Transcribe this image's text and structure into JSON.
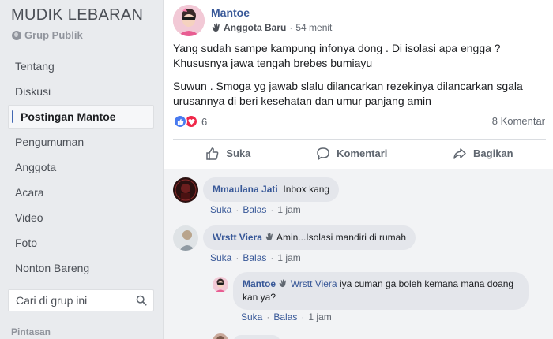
{
  "group": {
    "title": "MUDIK LEBARAN",
    "type": "Grup Publik"
  },
  "nav": {
    "items": [
      {
        "label": "Tentang"
      },
      {
        "label": "Diskusi"
      },
      {
        "label": "Postingan Mantoe"
      },
      {
        "label": "Pengumuman"
      },
      {
        "label": "Anggota"
      },
      {
        "label": "Acara"
      },
      {
        "label": "Video"
      },
      {
        "label": "Foto"
      },
      {
        "label": "Nonton Bareng"
      }
    ],
    "active_index": 2
  },
  "search": {
    "placeholder": "Cari di grup ini"
  },
  "shortcuts_label": "Pintasan",
  "post": {
    "author": "Mantoe",
    "badge": "Anggota Baru",
    "time": "54 menit",
    "paragraph1": "Yang sudah sampe kampung infonya dong . Di isolasi apa engga ? Khususnya jawa tengah brebes bumiayu",
    "paragraph2": "Suwun . Smoga yg jawab slalu dilancarkan rezekinya dilancarkan sgala urusannya di beri kesehatan dan umur panjang amin",
    "reaction_count": "6",
    "comment_count": "8 Komentar",
    "actions": {
      "like": "Suka",
      "comment": "Komentari",
      "share": "Bagikan"
    }
  },
  "comments": [
    {
      "author": "Mmaulana Jati",
      "text": "Inbox kang",
      "like": "Suka",
      "reply": "Balas",
      "time": "1 jam"
    },
    {
      "author": "Wrstt Viera",
      "text": "Amin...Isolasi mandiri di rumah",
      "like": "Suka",
      "reply": "Balas",
      "time": "1 jam"
    }
  ],
  "reply": {
    "author": "Mantoe",
    "mention": "Wrstt Viera",
    "text": "iya cuman ga boleh kemana mana doang kan ya?",
    "like": "Suka",
    "reply": "Balas",
    "time": "1 jam"
  },
  "colors": {
    "link": "#385898",
    "like_reaction": "#4a7bef",
    "love_reaction": "#f0284a",
    "sidebar_bg": "#e9ebee"
  }
}
